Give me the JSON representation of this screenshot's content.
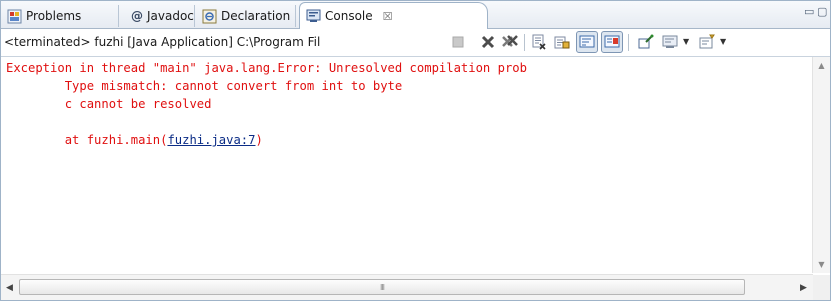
{
  "tabs": [
    {
      "label": "Problems",
      "icon": "problems-icon",
      "active": false
    },
    {
      "label": "Javadoc",
      "icon": "javadoc-at-icon",
      "active": false
    },
    {
      "label": "Declaration",
      "icon": "declaration-icon",
      "active": false
    },
    {
      "label": "Console",
      "icon": "console-icon",
      "active": true
    }
  ],
  "tab_close_glyph": "☒",
  "window_controls": {
    "minimize": "▭",
    "maximize": "▢"
  },
  "toolbar": {
    "status": "<terminated> fuzhi [Java Application] C:\\Program Fil",
    "buttons": [
      "terminate-icon",
      "remove-launch-icon",
      "remove-all-terminated-icon",
      "clear-console-icon",
      "scroll-lock-icon",
      "word-wrap-icon",
      "show-console-on-output-icon",
      "pin-console-icon",
      "display-console-icon",
      "open-console-icon"
    ]
  },
  "console": {
    "line1": "Exception in thread \"main\" java.lang.Error: Unresolved compilation prob",
    "line2": "\tType mismatch: cannot convert from int to byte",
    "line3": "\tc cannot be resolved",
    "line5_prefix": "\tat fuzhi.main(",
    "line5_link": "fuzhi.java:7",
    "line5_suffix": ")"
  },
  "scrollbar": {
    "grip": "III"
  },
  "colors": {
    "error_text": "#e01010",
    "link": "#0b2c86",
    "tab_border": "#9fb3c8"
  }
}
